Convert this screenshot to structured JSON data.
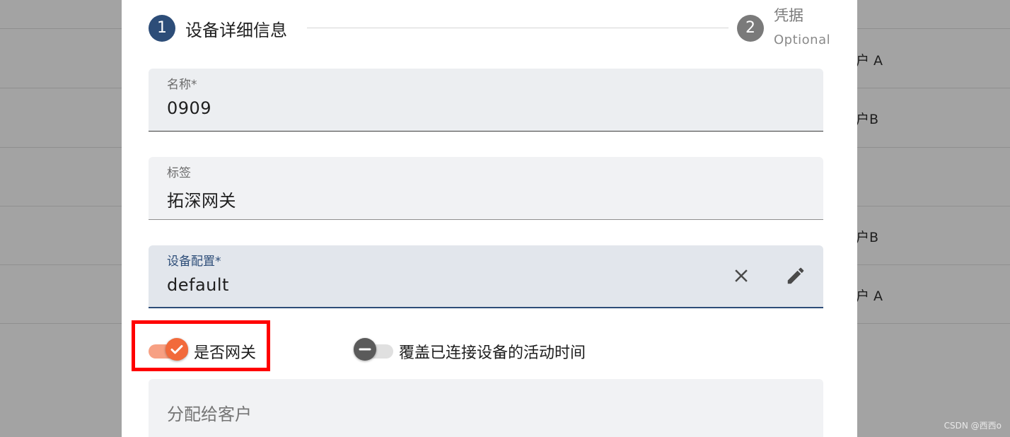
{
  "background_rows": [
    {
      "text": "户 A"
    },
    {
      "text": "户B"
    },
    {
      "text": "户B"
    },
    {
      "text": "户 A"
    }
  ],
  "watermark": "CSDN @西西o",
  "stepper": {
    "step1": {
      "number": "1",
      "label": "设备详细信息"
    },
    "step2": {
      "number": "2",
      "label": "凭据",
      "sublabel": "Optional"
    }
  },
  "fields": {
    "name": {
      "label": "名称*",
      "value": "0909"
    },
    "tag": {
      "label": "标签",
      "value": "拓深网关"
    },
    "profile": {
      "label": "设备配置*",
      "value": "default",
      "clear_icon": "close-icon",
      "edit_icon": "pencil-icon"
    }
  },
  "toggles": {
    "gateway": {
      "label": "是否网关",
      "checked": true
    },
    "overwrite_activity": {
      "label": "覆盖已连接设备的活动时间",
      "checked": false
    }
  },
  "assign_customer": {
    "placeholder": "分配给客户"
  },
  "colors": {
    "primary": "#2d4d78",
    "accent": "#f26a3b",
    "highlight": "#ff0000"
  }
}
